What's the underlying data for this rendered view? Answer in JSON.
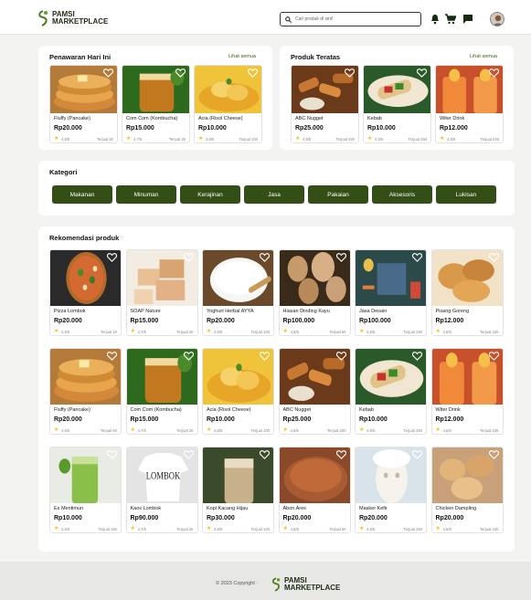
{
  "header": {
    "logo_line1": "PAMSI",
    "logo_line2": "MARKETPLACE",
    "search_placeholder": "Cari produk di sini!",
    "icons": [
      "bell-icon",
      "cart-icon",
      "chat-icon",
      "avatar"
    ]
  },
  "today": {
    "title": "Penawaran Hari Ini",
    "see_all": "Lihat semua",
    "items": [
      {
        "name": "Fluffy (Pancake)",
        "price": "Rp20.000",
        "rating": "4,5/5",
        "sold": "Terjual 50"
      },
      {
        "name": "Com Com (Kombucha)",
        "price": "Rp15.000",
        "rating": "4,7/5",
        "sold": "Terjual 25"
      },
      {
        "name": "Acia (Risol Cheese)",
        "price": "Rp10.000",
        "rating": "4,8/5",
        "sold": "Terjual 100"
      }
    ]
  },
  "top": {
    "title": "Produk Teratas",
    "see_all": "Lihat semua",
    "items": [
      {
        "name": "ABC Nugget",
        "price": "Rp25.000",
        "rating": "4,5/5",
        "sold": "Terjual 250"
      },
      {
        "name": "Kebab",
        "price": "Rp10.000",
        "rating": "4,5/5",
        "sold": "Terjual 250"
      },
      {
        "name": "Witer Drink",
        "price": "Rp12.000",
        "rating": "4,5/5",
        "sold": "Terjual 225"
      }
    ]
  },
  "categories": {
    "title": "Kategori",
    "items": [
      "Makanan",
      "Minuman",
      "Kerajinan",
      "Jasa",
      "Pakaian",
      "Aksesoris",
      "Lukisan"
    ]
  },
  "recommend": {
    "title": "Rekomendasi produk",
    "items": [
      {
        "name": "Pizza Lombok",
        "price": "Rp20.000",
        "rating": "4,5/5",
        "sold": "Terjual 10"
      },
      {
        "name": "SOAP Nature",
        "price": "Rp15.000",
        "rating": "4,7/5",
        "sold": "Terjual 25"
      },
      {
        "name": "Yoghurt Herbal AYYA",
        "price": "Rp20.000",
        "rating": "4,8/5",
        "sold": "Terjual 100"
      },
      {
        "name": "Hiasan Dinding Kayu",
        "price": "Rp100.000",
        "rating": "4,5/5",
        "sold": "Terjual 50"
      },
      {
        "name": "Jasa Desain",
        "price": "Rp100.000",
        "rating": "4,5/5",
        "sold": "Terjual 250"
      },
      {
        "name": "Pisang Goreng",
        "price": "Rp12.000",
        "rating": "4,5/5",
        "sold": "Terjual 225"
      },
      {
        "name": "Fluffy (Pancake)",
        "price": "Rp20.000",
        "rating": "4,5/5",
        "sold": "Terjual 50"
      },
      {
        "name": "Com Com (Kombucha)",
        "price": "Rp15.000",
        "rating": "4,7/5",
        "sold": "Terjual 25"
      },
      {
        "name": "Acia (Risol Cheese)",
        "price": "Rp10.000",
        "rating": "4,8/5",
        "sold": "Terjual 100"
      },
      {
        "name": "ABC Nugget",
        "price": "Rp25.000",
        "rating": "4,5/5",
        "sold": "Terjual 250"
      },
      {
        "name": "Kebab",
        "price": "Rp10.000",
        "rating": "4,5/5",
        "sold": "Terjual 250"
      },
      {
        "name": "Witer Drink",
        "price": "Rp12.000",
        "rating": "4,5/5",
        "sold": "Terjual 225"
      },
      {
        "name": "Es Mentimun",
        "price": "Rp10.000",
        "rating": "4,5/5",
        "sold": "Terjual 150"
      },
      {
        "name": "Kaos Lombok",
        "price": "Rp90.000",
        "rating": "4,7/5",
        "sold": "Terjual 25"
      },
      {
        "name": "Kopi Kacang Hijau",
        "price": "Rp30.000",
        "rating": "4,8/5",
        "sold": "Terjual 100"
      },
      {
        "name": "Abon Ares",
        "price": "Rp20.000",
        "rating": "4,5/5",
        "sold": "Terjual 50"
      },
      {
        "name": "Masker Kefir",
        "price": "Rp20.000",
        "rating": "4,5/5",
        "sold": "Terjual 250"
      },
      {
        "name": "Chicken Dampling",
        "price": "Rp20.000",
        "rating": "4,5/5",
        "sold": "Terjual 225"
      }
    ],
    "shirt_text": "LOMBOK"
  },
  "footer": {
    "copyright": "© 2023 Copyright :",
    "logo_line1": "PAMSI",
    "logo_line2": "MARKETPLACE"
  },
  "colors": {
    "primary": "#344f15",
    "star": "#f2c21b",
    "bg": "#f3f3f1"
  }
}
